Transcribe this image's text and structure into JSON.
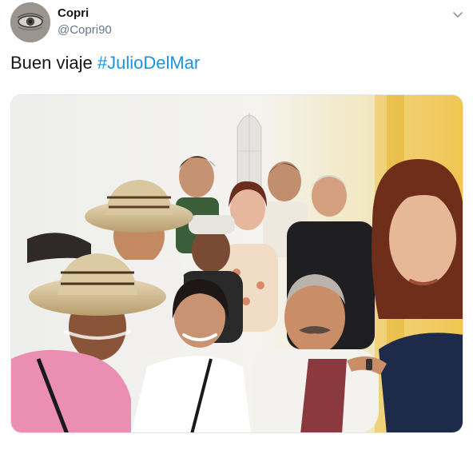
{
  "tweet": {
    "author": {
      "display_name": "Copri",
      "handle": "@Copri90",
      "avatar_icon": "eye-avatar-icon"
    },
    "text": "Buen viaje ",
    "hashtag": "#JulioDelMar",
    "menu_icon": "chevron-down-icon"
  },
  "colors": {
    "text_primary": "#14171a",
    "text_secondary": "#657786",
    "link": "#1b95e0",
    "border": "#e1e8ed"
  }
}
